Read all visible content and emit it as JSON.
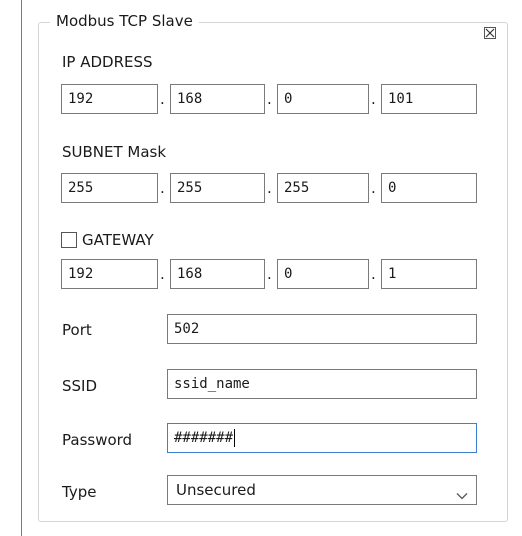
{
  "group_title": "Modbus TCP Slave",
  "ip": {
    "label": "IP ADDRESS",
    "octets": [
      "192",
      "168",
      "0",
      "101"
    ]
  },
  "subnet": {
    "label": "SUBNET Mask",
    "octets": [
      "255",
      "255",
      "255",
      "0"
    ]
  },
  "gateway": {
    "label": "GATEWAY",
    "checked": false,
    "octets": [
      "192",
      "168",
      "0",
      "1"
    ]
  },
  "separator": ".",
  "port": {
    "label": "Port",
    "value": "502"
  },
  "ssid": {
    "label": "SSID",
    "value": "ssid_name"
  },
  "password": {
    "label": "Password",
    "value": "#######"
  },
  "type": {
    "label": "Type",
    "selected": "Unsecured"
  },
  "icons": {
    "close": "close-box-icon",
    "dropdown": "chevron-down-icon"
  },
  "colors": {
    "focus_border": "#3f7fd0",
    "left_edge": "#4a86c8"
  }
}
